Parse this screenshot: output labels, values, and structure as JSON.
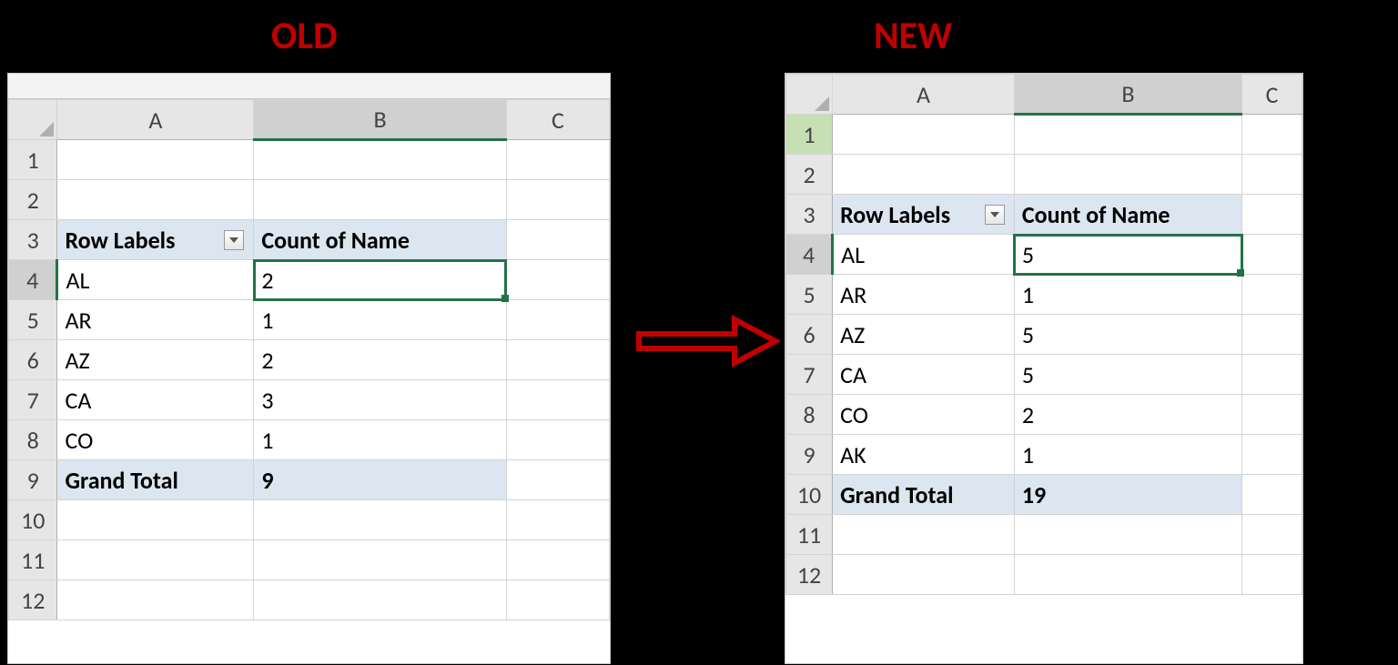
{
  "labels": {
    "old": "OLD",
    "new": "NEW"
  },
  "columns": [
    "A",
    "B",
    "C"
  ],
  "pivot_headers": {
    "row_labels": "Row Labels",
    "count": "Count of Name"
  },
  "old": {
    "row_numbers": [
      "1",
      "2",
      "3",
      "4",
      "5",
      "6",
      "7",
      "8",
      "9",
      "10",
      "11",
      "12"
    ],
    "rows": [
      {
        "label": "AL",
        "value": "2"
      },
      {
        "label": "AR",
        "value": "1"
      },
      {
        "label": "AZ",
        "value": "2"
      },
      {
        "label": "CA",
        "value": "3"
      },
      {
        "label": "CO",
        "value": "1"
      }
    ],
    "total_label": "Grand Total",
    "total_value": "9",
    "active_cell": "B4",
    "active_value": "2"
  },
  "new": {
    "row_numbers": [
      "1",
      "2",
      "3",
      "4",
      "5",
      "6",
      "7",
      "8",
      "9",
      "10",
      "11",
      "12"
    ],
    "rows": [
      {
        "label": "AL",
        "value": "5"
      },
      {
        "label": "AR",
        "value": "1"
      },
      {
        "label": "AZ",
        "value": "5"
      },
      {
        "label": "CA",
        "value": "5"
      },
      {
        "label": "CO",
        "value": "2"
      },
      {
        "label": "AK",
        "value": "1"
      }
    ],
    "total_label": "Grand Total",
    "total_value": "19",
    "active_cell": "B4",
    "active_value": "5"
  }
}
